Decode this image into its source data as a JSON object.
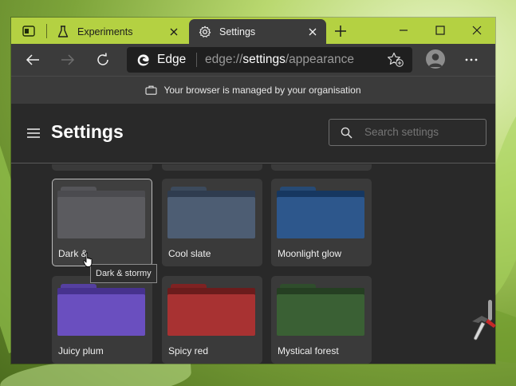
{
  "tabs": [
    {
      "title": "Experiments",
      "icon": "flask-icon",
      "active": false
    },
    {
      "title": "Settings",
      "icon": "gear-icon",
      "active": true
    }
  ],
  "toolbar": {
    "address": {
      "brand": "Edge",
      "url_prefix": "edge://",
      "url_strong": "settings",
      "url_suffix": "/appearance"
    }
  },
  "banner": {
    "text": "Your browser is managed by your organisation",
    "icon": "briefcase-icon"
  },
  "settings": {
    "title": "Settings",
    "search_placeholder": "Search settings"
  },
  "themes": [
    {
      "name": "Dark & stormy",
      "label_visible": "Dark &",
      "tab_color": "#555559",
      "back_color": "#4b4b4f",
      "front_color": "#5b5b5f",
      "selected": true
    },
    {
      "name": "Cool slate",
      "tab_color": "#3c4a5c",
      "back_color": "#2f3c4f",
      "front_color": "#4d5d73",
      "selected": false
    },
    {
      "name": "Moonlight glow",
      "tab_color": "#264a75",
      "back_color": "#163760",
      "front_color": "#2d578c",
      "selected": false
    },
    {
      "name": "Juicy plum",
      "tab_color": "#5540a0",
      "back_color": "#47328e",
      "front_color": "#6a4fbf",
      "selected": false
    },
    {
      "name": "Spicy red",
      "tab_color": "#7f2222",
      "back_color": "#6b1c1c",
      "front_color": "#a83232",
      "selected": false
    },
    {
      "name": "Mystical forest",
      "tab_color": "#2f4d2c",
      "back_color": "#253f22",
      "front_color": "#3a6034",
      "selected": false
    }
  ],
  "tooltip": {
    "text": "Dark & stormy"
  },
  "colors": {
    "tab_strip": "#b4d142",
    "toolbar": "#3b3b3b",
    "page": "#292929"
  }
}
